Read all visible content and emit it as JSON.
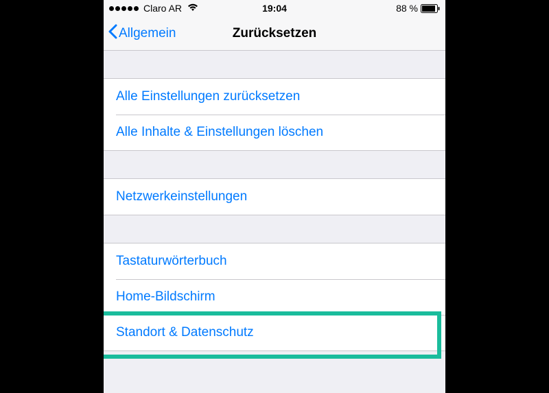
{
  "status_bar": {
    "carrier": "Claro AR",
    "time": "19:04",
    "battery_pct": "88 %"
  },
  "nav": {
    "back_label": "Allgemein",
    "title": "Zurücksetzen"
  },
  "group1": {
    "items": [
      {
        "label": "Alle Einstellungen zurücksetzen"
      },
      {
        "label": "Alle Inhalte & Einstellungen löschen"
      }
    ]
  },
  "group2": {
    "items": [
      {
        "label": "Netzwerkeinstellungen"
      }
    ]
  },
  "group3": {
    "items": [
      {
        "label": "Tastaturwörterbuch"
      },
      {
        "label": "Home-Bildschirm"
      },
      {
        "label": "Standort & Datenschutz"
      }
    ]
  }
}
